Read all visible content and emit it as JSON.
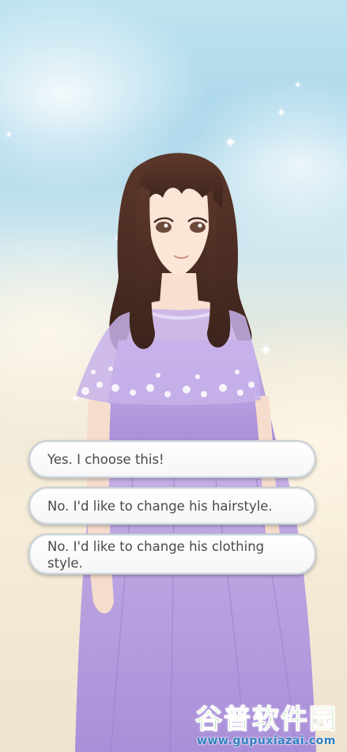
{
  "dialog": {
    "choices": [
      {
        "label": "Yes. I choose this!"
      },
      {
        "label": "No. I'd like to change his hairstyle."
      },
      {
        "label": "No. I'd like to change his clothing style."
      }
    ]
  },
  "watermark": {
    "title": "谷普软件园",
    "url": "www.gupuxiazai.com"
  },
  "colors": {
    "dress": "#b9a2dd",
    "hair": "#4a2c22",
    "button_border": "#c9d0d6"
  }
}
